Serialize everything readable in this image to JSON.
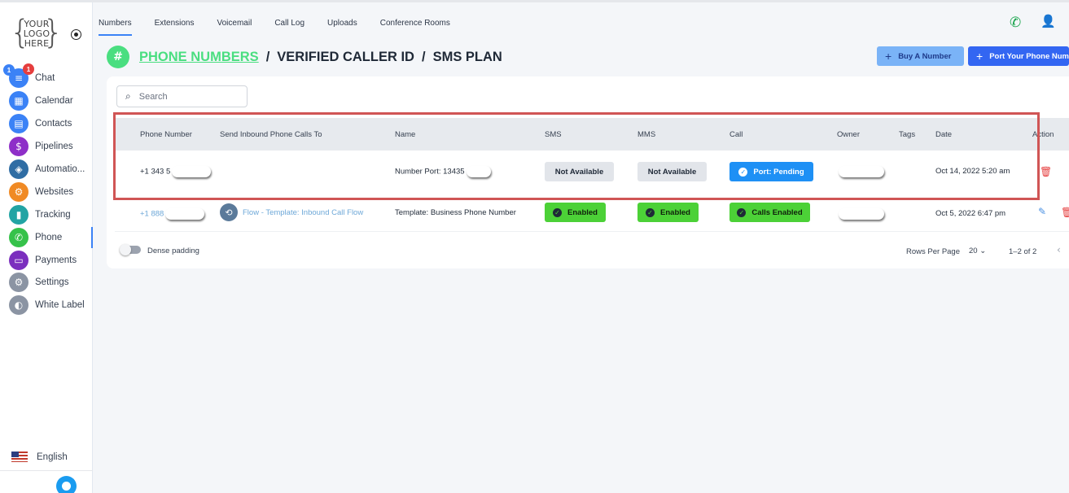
{
  "logo": {
    "line1": "YOUR",
    "line2": "LOGO",
    "line3": "HERE"
  },
  "sidebar": {
    "items": [
      {
        "label": "Chat",
        "icon": "chat-icon",
        "color": "#3b82f6"
      },
      {
        "label": "Calendar",
        "icon": "calendar-icon",
        "color": "#3b82f6"
      },
      {
        "label": "Contacts",
        "icon": "contacts-icon",
        "color": "#3b82f6"
      },
      {
        "label": "Pipelines",
        "icon": "pipelines-icon",
        "color": "#8e2fc8"
      },
      {
        "label": "Automatio...",
        "icon": "automation-icon",
        "color": "#2f6da4"
      },
      {
        "label": "Websites",
        "icon": "websites-icon",
        "color": "#f08a24"
      },
      {
        "label": "Tracking",
        "icon": "tracking-icon",
        "color": "#22a4a4"
      },
      {
        "label": "Phone",
        "icon": "phone-icon",
        "color": "#36c24a"
      },
      {
        "label": "Payments",
        "icon": "payments-icon",
        "color": "#7b2fbe"
      },
      {
        "label": "Settings",
        "icon": "settings-icon",
        "color": "#8b94a3"
      },
      {
        "label": "White Label",
        "icon": "palette-icon",
        "color": "#8b94a3"
      }
    ],
    "chat_badges": {
      "blue": "1",
      "red": "1"
    },
    "language": "English"
  },
  "tabs": [
    "Numbers",
    "Extensions",
    "Voicemail",
    "Call Log",
    "Uploads",
    "Conference Rooms"
  ],
  "heading": {
    "link": "PHONE NUMBERS",
    "sep": "/",
    "part2": "VERIFIED CALLER ID",
    "part3": "SMS PLAN"
  },
  "buttons": {
    "buy": "Buy A Number",
    "port": "Port Your Phone Number",
    "plus": "+"
  },
  "search": {
    "placeholder": "Search"
  },
  "columns": [
    "Phone Number",
    "Send Inbound Phone Calls To",
    "Name",
    "SMS",
    "MMS",
    "Call",
    "Owner",
    "Tags",
    "Date",
    "Action"
  ],
  "rows": [
    {
      "phone": "+1 343 5",
      "send_to": "",
      "name": "Number Port: 13435",
      "sms": "Not Available",
      "mms": "Not Available",
      "call": "Port: Pending",
      "date": "Oct 14, 2022 5:20 am"
    },
    {
      "phone": "+1 888",
      "send_to": "Flow - Template: Inbound Call Flow",
      "name": "Template: Business Phone Number",
      "sms": "Enabled",
      "mms": "Enabled",
      "call": "Calls Enabled",
      "date": "Oct 5, 2022 6:47 pm"
    }
  ],
  "footer": {
    "dense": "Dense padding",
    "rows_per_page": "Rows Per Page",
    "rows_value": "20",
    "range": "1–2 of 2"
  },
  "colors": {
    "accent": "#3b82f6",
    "green": "#4ade80",
    "highlight": "#d05555"
  }
}
